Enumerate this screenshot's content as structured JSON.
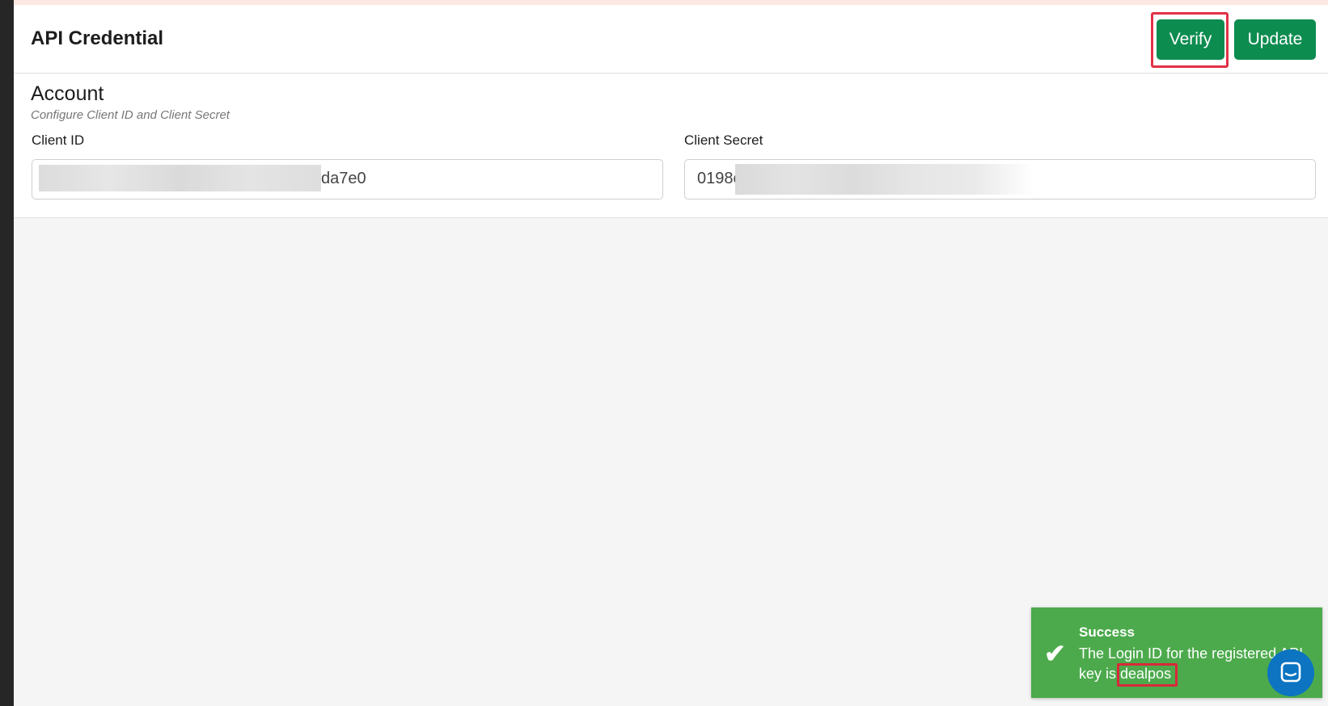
{
  "header": {
    "title": "API Credential",
    "verify_label": "Verify",
    "update_label": "Update"
  },
  "account": {
    "title": "Account",
    "subtitle": "Configure Client ID and Client Secret",
    "client_id_label": "Client ID",
    "client_id_value_visible": "da7e0",
    "client_secret_label": "Client Secret",
    "client_secret_value_visible": "0198c"
  },
  "toast": {
    "title": "Success",
    "message_prefix": "The Login ID for the registered API key is ",
    "login_id": "dealpos",
    "icon": "check-icon"
  },
  "colors": {
    "primary_button": "#0d8c50",
    "toast_background": "#4caa4c",
    "chat_button": "#0c74c1",
    "highlight_border": "#e13246"
  }
}
